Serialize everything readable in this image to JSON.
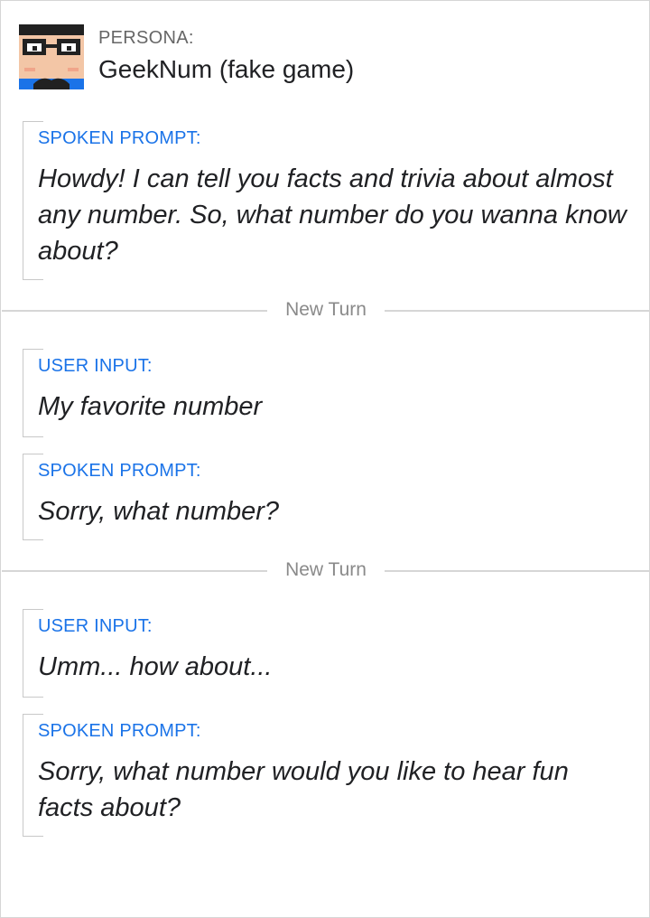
{
  "persona": {
    "label": "PERSONA:",
    "name": "GeekNum (fake game)",
    "avatar_icon": "nerd-glasses-avatar-icon"
  },
  "turns": [
    {
      "blocks": [
        {
          "label": "SPOKEN PROMPT:",
          "text": "Howdy! I can tell you facts and trivia about almost any number. So, what number do you wanna know about?"
        }
      ]
    },
    {
      "divider": "New Turn",
      "blocks": [
        {
          "label": "USER INPUT:",
          "text": "My favorite number"
        },
        {
          "label": "SPOKEN PROMPT:",
          "text": "Sorry, what number?"
        }
      ]
    },
    {
      "divider": "New Turn",
      "blocks": [
        {
          "label": "USER INPUT:",
          "text": "Umm... how about..."
        },
        {
          "label": "SPOKEN PROMPT:",
          "text": "Sorry, what number would you like to hear fun facts about?"
        }
      ]
    }
  ],
  "colors": {
    "label_blue": "#1a73e8",
    "avatar_dark": "#212121",
    "avatar_skin": "#f3c6a6",
    "avatar_blue": "#1a73e8"
  }
}
